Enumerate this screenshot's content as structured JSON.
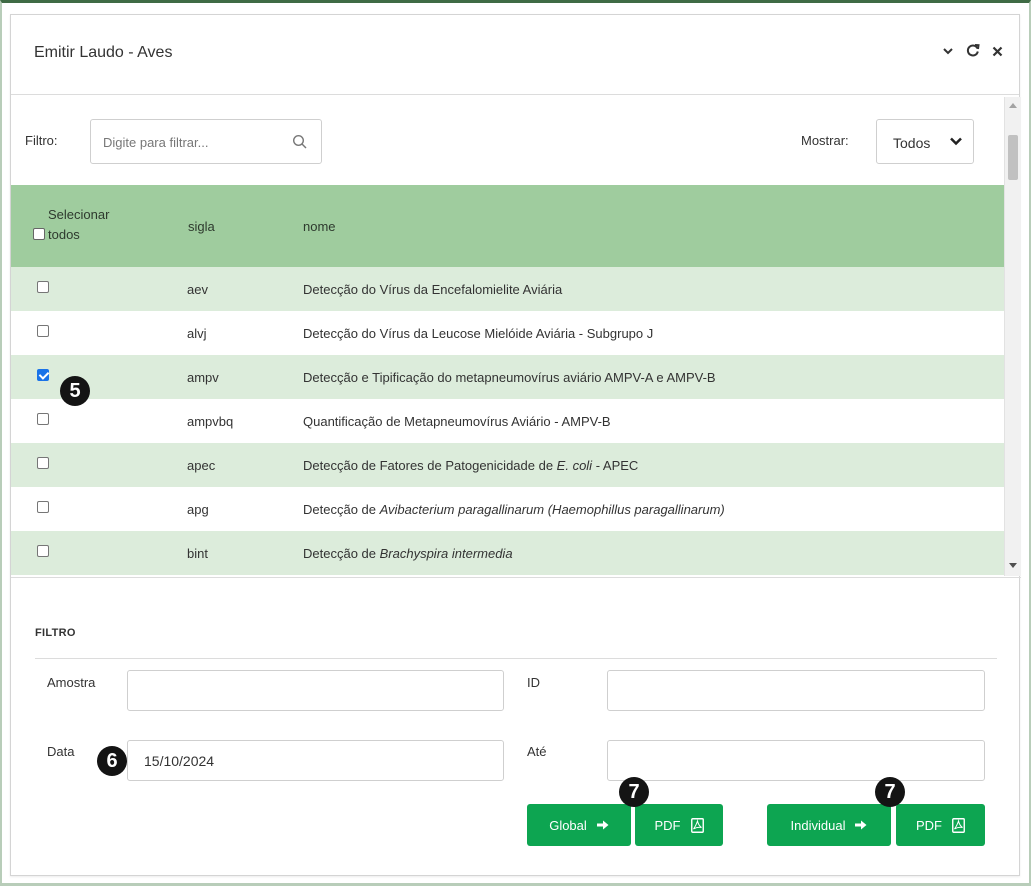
{
  "window": {
    "title": "Emitir Laudo - Aves",
    "collapse_icon": "chevron-down-icon",
    "refresh_icon": "refresh-icon",
    "close_icon": "close-icon"
  },
  "filter": {
    "label": "Filtro:",
    "placeholder": "Digite para filtrar...",
    "value": "",
    "search_icon": "search-icon",
    "show_label": "Mostrar:",
    "show_value": "Todos"
  },
  "table": {
    "headers": {
      "select_all": "Selecionar todos",
      "sigla": "sigla",
      "nome": "nome"
    },
    "rows": [
      {
        "checked": false,
        "sigla": "aev",
        "nome_parts": [
          {
            "t": "Detecção do Vírus da Encefalomielite Aviária",
            "i": false
          }
        ]
      },
      {
        "checked": false,
        "sigla": "alvj",
        "nome_parts": [
          {
            "t": "Detecção do Vírus da Leucose Mielóide Aviária - Subgrupo J",
            "i": false
          }
        ]
      },
      {
        "checked": true,
        "sigla": "ampv",
        "nome_parts": [
          {
            "t": "Detecção e Tipificação do metapneumovírus aviário AMPV-A e AMPV-B",
            "i": false
          }
        ]
      },
      {
        "checked": false,
        "sigla": "ampvbq",
        "nome_parts": [
          {
            "t": "Quantificação de Metapneumovírus Aviário - AMPV-B",
            "i": false
          }
        ]
      },
      {
        "checked": false,
        "sigla": "apec",
        "nome_parts": [
          {
            "t": "Detecção de Fatores de Patogenicidade de ",
            "i": false
          },
          {
            "t": "E. coli",
            "i": true
          },
          {
            "t": " - APEC",
            "i": false
          }
        ]
      },
      {
        "checked": false,
        "sigla": "apg",
        "nome_parts": [
          {
            "t": "Detecção de ",
            "i": false
          },
          {
            "t": "Avibacterium paragallinarum (Haemophillus paragallinarum)",
            "i": true
          }
        ]
      },
      {
        "checked": false,
        "sigla": "bint",
        "nome_parts": [
          {
            "t": "Detecção de ",
            "i": false
          },
          {
            "t": "Brachyspira intermedia",
            "i": true
          }
        ]
      }
    ]
  },
  "annotations": {
    "step5": "5",
    "step6": "6",
    "step7a": "7",
    "step7b": "7"
  },
  "form": {
    "section_title": "FILTRO",
    "amostra_label": "Amostra",
    "amostra_value": "",
    "id_label": "ID",
    "id_value": "",
    "data_label": "Data",
    "data_value": "15/10/2024",
    "ate_label": "Até",
    "ate_value": ""
  },
  "buttons": {
    "global": "Global",
    "pdf1": "PDF",
    "individual": "Individual",
    "pdf2": "PDF",
    "arrow_icon": "arrow-right-icon",
    "pdf_icon": "pdf-file-icon"
  },
  "colors": {
    "header_green": "#9fcc9e",
    "row_alt": "#dcecdb",
    "button_green": "#0da551",
    "badge": "#141414"
  }
}
